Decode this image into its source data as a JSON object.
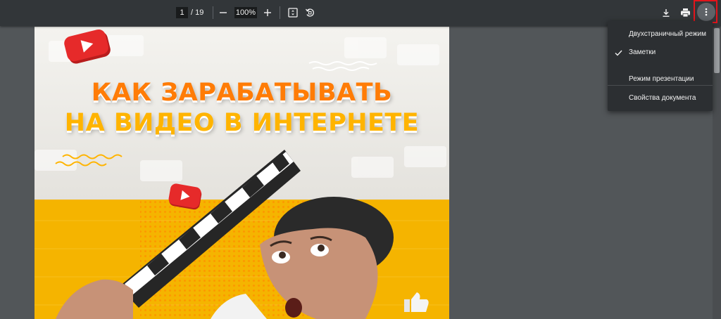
{
  "toolbar": {
    "page_current": "1",
    "page_total": "/ 19",
    "zoom": "100%",
    "icons": [
      "minus-icon",
      "plus-icon",
      "fit-page-icon",
      "rotate-icon",
      "download-icon",
      "print-icon",
      "more-vert-icon"
    ]
  },
  "document": {
    "title_line1": "КАК ЗАРАБАТЫВАТЬ",
    "title_line2": "НА ВИДЕО В ИНТЕРНЕТЕ"
  },
  "menu": {
    "items": [
      {
        "label": "Двухстраничный режим",
        "checked": false
      },
      {
        "label": "Заметки",
        "checked": true
      },
      {
        "label": "Режим презентации",
        "checked": false
      },
      {
        "label": "Свойства документа",
        "checked": false
      }
    ]
  },
  "colors": {
    "toolbar_bg": "#323639",
    "viewer_bg": "#525659",
    "menu_bg": "#2c2f32",
    "highlight": "#e3141b",
    "title_orange": "#ff7c06",
    "title_yellow": "#ffb400",
    "page_yellow": "#f5b400",
    "youtube_red": "#e62a2a"
  }
}
